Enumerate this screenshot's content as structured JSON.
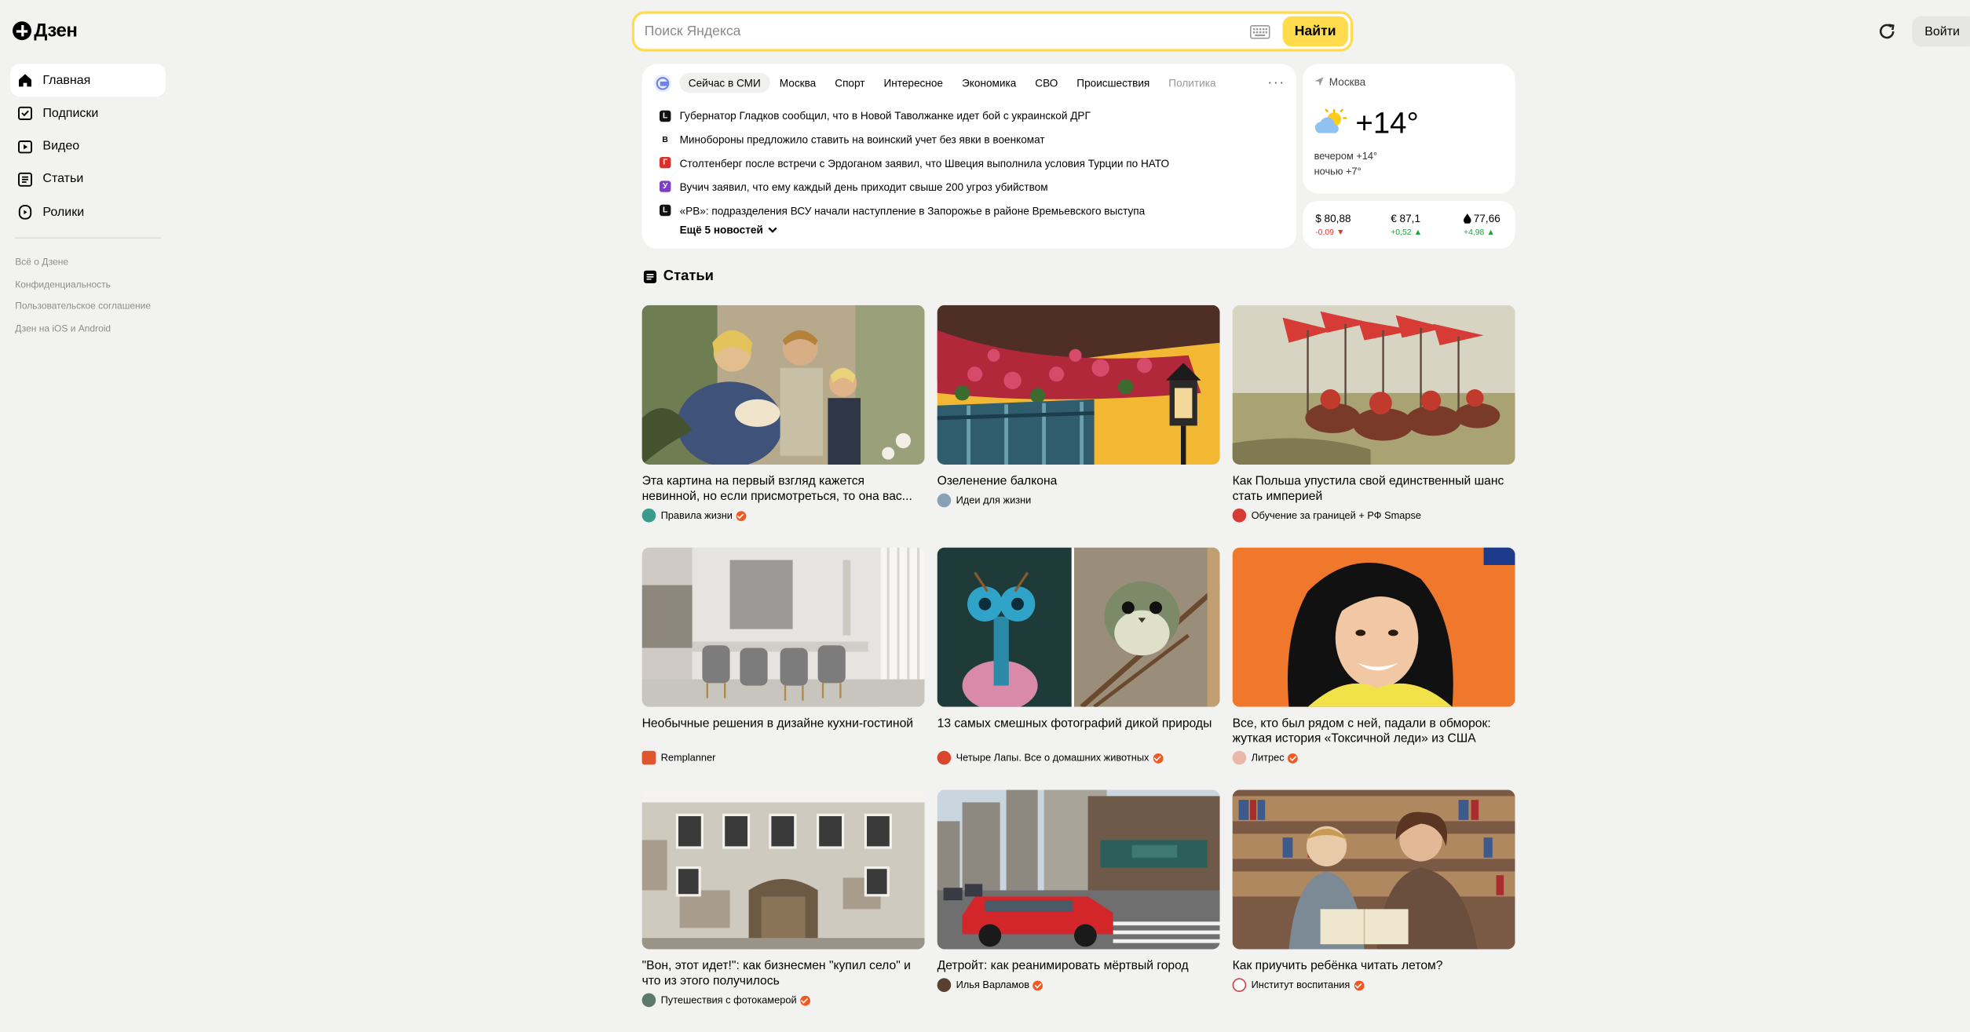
{
  "brand": {
    "name": "Дзен"
  },
  "search": {
    "placeholder": "Поиск Яндекса",
    "button": "Найти"
  },
  "header": {
    "login": "Войти"
  },
  "nav": {
    "items": [
      {
        "label": "Главная",
        "icon": "home-icon"
      },
      {
        "label": "Подписки",
        "icon": "subscriptions-icon"
      },
      {
        "label": "Видео",
        "icon": "video-icon"
      },
      {
        "label": "Статьи",
        "icon": "articles-icon"
      },
      {
        "label": "Ролики",
        "icon": "shorts-icon"
      }
    ],
    "footer": [
      "Всё о Дзене",
      "Конфиденциальность",
      "Пользовательское соглашение",
      "Дзен на iOS и Android"
    ]
  },
  "news": {
    "tabs": [
      "Сейчас в СМИ",
      "Москва",
      "Спорт",
      "Интересное",
      "Экономика",
      "СВО",
      "Происшествия",
      "Политика"
    ],
    "items": [
      {
        "text": "Губернатор Гладков сообщил, что в Новой Таволжанке идет бой с украинской ДРГ",
        "src": "L",
        "color": "#111111"
      },
      {
        "text": "Минобороны предложило ставить на воинский учет без явки в военкомат",
        "src": "В",
        "color": "#ffffff"
      },
      {
        "text": "Столтенберг после встречи с Эрдоганом заявил, что Швеция выполнила условия Турции по НАТО",
        "src": "Г",
        "color": "#d9302c"
      },
      {
        "text": "Вучич заявил, что ему каждый день приходит свыше 200 угроз убийством",
        "src": "У",
        "color": "#7d3fc4"
      },
      {
        "text": "«РВ»: подразделения ВСУ начали наступление в Запорожье в районе Времьевского выступа",
        "src": "L",
        "color": "#111111"
      }
    ],
    "more": "Ещё 5 новостей"
  },
  "weather": {
    "city": "Москва",
    "temp": "+14°",
    "evening": "вечером +14°",
    "night": "ночью +7°"
  },
  "rates": [
    {
      "label": "$ 80,88",
      "change": "-0,09",
      "trend": "down"
    },
    {
      "label": "€ 87,1",
      "change": "+0,52",
      "trend": "up"
    },
    {
      "label": "77,66",
      "change": "+4,98",
      "trend": "up",
      "icon": "oil-drop-icon"
    }
  ],
  "section": {
    "title": "Статьи"
  },
  "cards": [
    {
      "title": "Эта картина на первый взгляд кажется невинной, но если присмотреться, то она вас...",
      "source": "Правила жизни",
      "verified": true,
      "avatar": "#3a9a8c"
    },
    {
      "title": "Озеленение балкона",
      "source": "Идеи для жизни",
      "verified": false,
      "avatar": "#8aa0b5"
    },
    {
      "title": "Как Польша упустила свой единственный шанс стать империей",
      "source": "Обучение за границей + РФ Smapse",
      "verified": false,
      "avatar": "#d63b36"
    },
    {
      "title": "Необычные решения в дизайне кухни-гостиной",
      "source": "Remplanner",
      "verified": false,
      "avatar": "#e0542e"
    },
    {
      "title": "13 самых смешных фотографий дикой природы",
      "source": "Четыре Лапы. Все о домашних животных",
      "verified": true,
      "avatar": "#d8472c"
    },
    {
      "title": "Все, кто был рядом с ней, падали в обморок: жуткая история «Токсичной леди» из США",
      "source": "Литрес",
      "verified": true,
      "avatar": "#e8b8a8"
    },
    {
      "title": "\"Вон, этот идет!\": как бизнесмен \"купил село\" и что из этого получилось",
      "source": "Путешествия с фотокамерой",
      "verified": true,
      "avatar": "#5a7a6a"
    },
    {
      "title": "Детройт: как реанимировать мёртвый город",
      "source": "Илья Варламов",
      "verified": true,
      "avatar": "#5a4030"
    },
    {
      "title": "Как приучить ребёнка читать летом?",
      "source": "Институт воспитания",
      "verified": true,
      "avatar": "#d04040"
    }
  ],
  "colors": {
    "accent": "#ffdb4d",
    "verified": "#f05a22",
    "down": "#e8322c",
    "up": "#1ca23a"
  }
}
